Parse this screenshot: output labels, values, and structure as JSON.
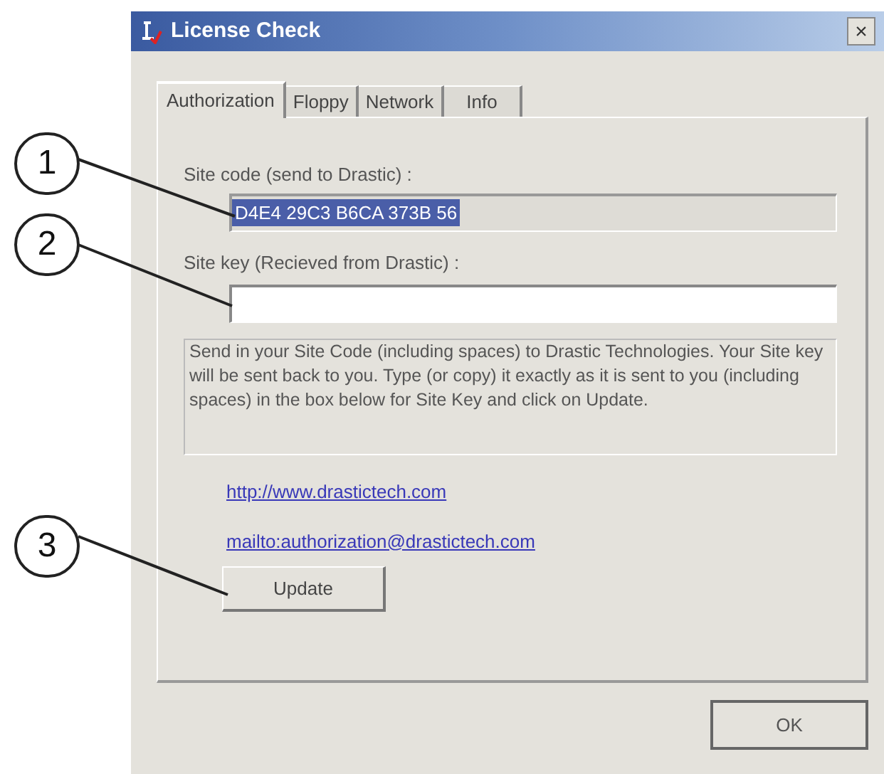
{
  "window": {
    "title": "License Check",
    "close": "×"
  },
  "tabs": [
    {
      "label": "Authorization",
      "selected": true
    },
    {
      "label": "Floppy",
      "selected": false
    },
    {
      "label": "Network",
      "selected": false
    },
    {
      "label": "Info",
      "selected": false
    }
  ],
  "site_code": {
    "label": "Site code (send to Drastic) :",
    "value": "D4E4 29C3 B6CA 373B 56",
    "selected": true
  },
  "site_key": {
    "label": "Site key (Recieved from Drastic) :"
  },
  "description": "Send in your Site Code (including spaces) to Drastic Technologies. Your Site key will be sent back to you. Type (or copy) it exactly as it is sent to you (including spaces) in the box below for Site Key and click on Update.",
  "links": [
    "http://www.drastictech.com",
    "mailto:authorization@drastictech.com"
  ],
  "buttons": {
    "update": "Update",
    "ok": "OK"
  },
  "callouts": [
    "1",
    "2",
    "3"
  ]
}
